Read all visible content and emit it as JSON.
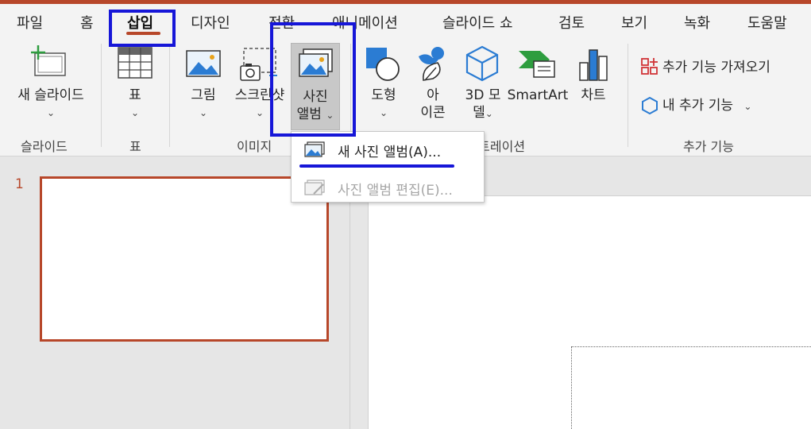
{
  "tabs": [
    "파일",
    "홈",
    "삽입",
    "디자인",
    "전환",
    "애니메이션",
    "슬라이드 쇼",
    "검토",
    "보기",
    "녹화",
    "도움말"
  ],
  "ribbon": {
    "new_slide": "새 슬라이드",
    "table": "표",
    "picture": "그림",
    "screenshot": "스크린샷",
    "photo_album_line1": "사진",
    "photo_album_line2": "앨범",
    "shapes": "도형",
    "icons_line1": "아",
    "icons_line2": "이콘",
    "model3d_line1": "3D 모",
    "model3d_line2": "델",
    "smartart": "SmartArt",
    "chart": "차트",
    "get_addins": "추가 기능 가져오기",
    "my_addins": "내 추가 기능"
  },
  "groups": {
    "slides": "슬라이드",
    "tables": "표",
    "images": "이미지",
    "illustrations": "일러스트레이션",
    "addins": "추가 기능"
  },
  "menu": {
    "new_album": "새 사진 앨범(A)...",
    "edit_album": "사진 앨범 편집(E)..."
  },
  "slide_number": "1",
  "colors": {
    "accent": "#b7472a",
    "highlight": "#1616d8"
  }
}
